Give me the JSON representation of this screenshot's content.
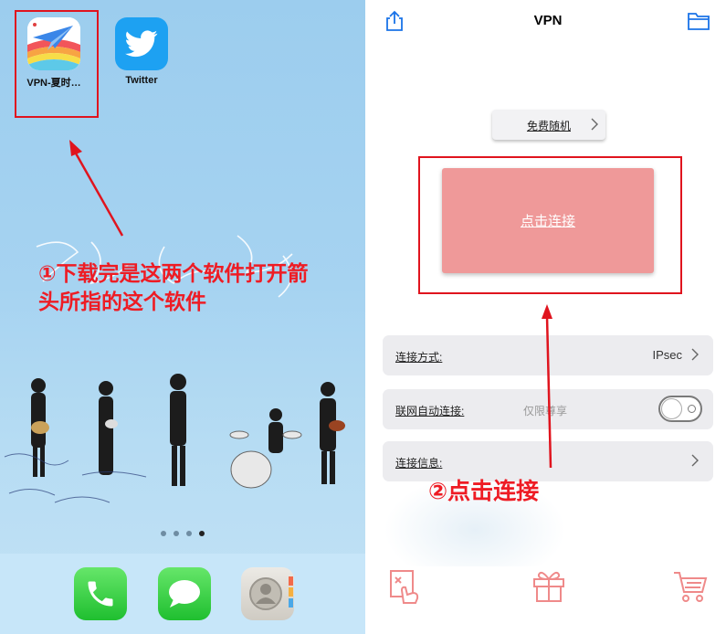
{
  "home_screen": {
    "apps": [
      {
        "label": "VPN-夏时…",
        "icon": "paper-plane-rainbow-icon"
      },
      {
        "label": "Twitter",
        "icon": "twitter-bird-icon"
      }
    ],
    "instruction": "①下载完是这两个软件打开箭头所指的这个软件",
    "page_dots": 4,
    "active_page": 4,
    "dock": [
      {
        "icon": "phone-icon"
      },
      {
        "icon": "messages-icon"
      },
      {
        "icon": "contacts-icon"
      }
    ]
  },
  "vpn_app": {
    "title": "VPN",
    "mode_button": "免费随机",
    "connect_button": "点击连接",
    "rows": {
      "method_label": "连接方式:",
      "method_value": "IPsec",
      "auto_label": "联网自动连接:",
      "auto_value": "仅限尊享",
      "info_label": "连接信息:"
    },
    "instruction": "②点击连接",
    "bottom_icons": [
      "feedback-icon",
      "gift-icon",
      "cart-icon"
    ]
  },
  "colors": {
    "annotation_red": "#ee1c24",
    "connect_button": "#ef9999",
    "icon_pink": "#ef8a8a",
    "nav_blue": "#1a73e8"
  }
}
